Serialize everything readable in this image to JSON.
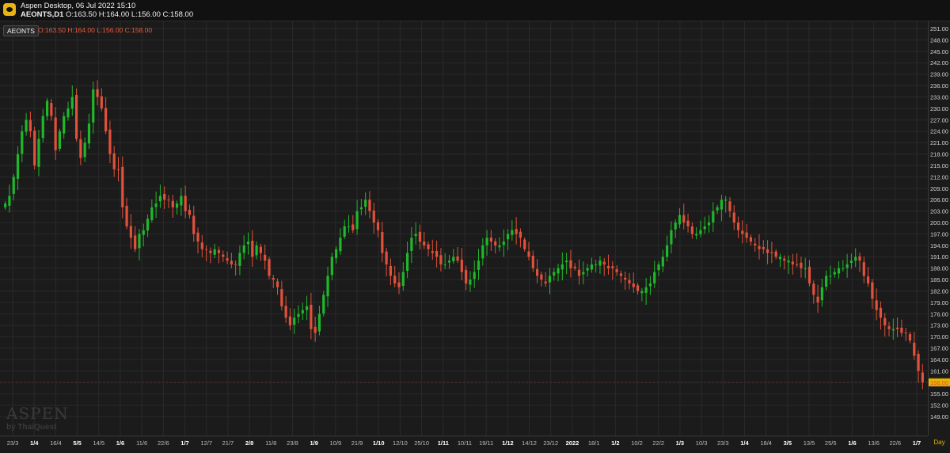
{
  "window": {
    "title": "Aspen Desktop, 06 Jul 2022 15:10",
    "symbol_interval": "AEONTS,D1",
    "ohlc_summary": "O:163.50 H:164.00 L:156.00 C:158.00"
  },
  "legend": {
    "symbol": "AEONTS",
    "ohlc": "O:163.50  H:164.00  L:156.00  C:158.00"
  },
  "watermark": {
    "brand": "ASPEN",
    "by": "by ThaiQuest"
  },
  "period": "Day",
  "colors": {
    "up": "#1fb82a",
    "down": "#e2513a",
    "accent": "#e8b400",
    "grid": "#2a2a2a"
  },
  "chart_data": {
    "type": "candlestick",
    "symbol": "AEONTS",
    "interval": "D1",
    "ylim": [
      149.0,
      251.0
    ],
    "price_ticks": [
      251.0,
      248.0,
      245.0,
      242.0,
      239.0,
      236.0,
      233.0,
      230.0,
      227.0,
      224.0,
      221.0,
      218.0,
      215.0,
      212.0,
      209.0,
      206.0,
      203.0,
      200.0,
      197.0,
      194.0,
      191.0,
      188.0,
      185.0,
      182.0,
      179.0,
      176.0,
      173.0,
      170.0,
      167.0,
      164.0,
      161.0,
      158.0,
      155.0,
      152.0,
      149.0
    ],
    "last_price": 158.0,
    "last_price_label": "158.00",
    "time_labels": [
      "23/3",
      "1/4",
      "16/4",
      "5/5",
      "14/5",
      "1/6",
      "11/6",
      "22/6",
      "1/7",
      "12/7",
      "21/7",
      "2/8",
      "11/8",
      "23/8",
      "1/9",
      "10/9",
      "21/9",
      "1/10",
      "12/10",
      "25/10",
      "1/11",
      "10/11",
      "19/11",
      "1/12",
      "14/12",
      "23/12",
      "2022",
      "18/1",
      "1/2",
      "10/2",
      "22/2",
      "1/3",
      "10/3",
      "23/3",
      "1/4",
      "18/4",
      "3/5",
      "13/5",
      "25/5",
      "1/6",
      "13/6",
      "22/6",
      "1/7"
    ],
    "bold_time_labels": [
      "1/4",
      "5/5",
      "1/6",
      "1/7",
      "2/8",
      "1/9",
      "1/10",
      "1/11",
      "1/12",
      "2022",
      "1/2",
      "1/3",
      "1/4",
      "3/5",
      "1/6",
      "1/7"
    ],
    "closes": [
      205,
      207,
      212,
      218,
      224,
      227,
      224,
      215,
      222,
      228,
      232,
      228,
      219,
      224,
      228,
      230,
      233,
      222,
      217,
      221,
      226,
      235,
      233,
      230,
      224,
      218,
      214,
      214,
      204,
      199,
      196,
      193,
      197,
      198,
      201,
      204,
      205,
      207,
      206,
      206,
      204,
      205,
      207,
      203,
      202,
      197,
      195,
      193,
      193,
      192,
      193,
      192,
      191,
      190,
      189,
      189,
      192,
      194,
      195,
      191,
      194,
      192,
      190,
      186,
      185,
      183,
      178,
      175,
      173,
      175,
      176,
      177,
      178,
      172,
      171,
      176,
      181,
      186,
      191,
      193,
      196,
      199,
      199,
      198,
      203,
      204,
      206,
      203,
      200,
      198,
      192,
      189,
      186,
      184,
      183,
      187,
      192,
      196,
      197,
      195,
      194,
      193,
      192,
      191,
      189,
      189,
      190,
      191,
      190,
      187,
      184,
      185,
      187,
      190,
      194,
      196,
      195,
      194,
      194,
      195,
      197,
      198,
      197,
      196,
      193,
      191,
      188,
      186,
      185,
      184,
      186,
      187,
      188,
      189,
      190,
      188,
      188,
      186,
      187,
      188,
      189,
      189,
      190,
      189,
      188,
      188,
      187,
      186,
      185,
      184,
      183,
      182,
      182,
      183,
      184,
      187,
      189,
      191,
      194,
      198,
      200,
      202,
      200,
      199,
      197,
      197,
      198,
      199,
      200,
      203,
      204,
      206,
      206,
      203,
      200,
      198,
      197,
      196,
      195,
      194,
      193,
      193,
      192,
      192,
      191,
      191,
      190,
      190,
      189,
      189,
      188,
      188,
      184,
      181,
      179,
      183,
      186,
      186,
      187,
      188,
      188,
      189,
      190,
      191,
      190,
      186,
      184,
      180,
      177,
      175,
      173,
      172,
      172,
      172,
      171,
      171,
      169,
      165,
      161,
      158
    ]
  }
}
